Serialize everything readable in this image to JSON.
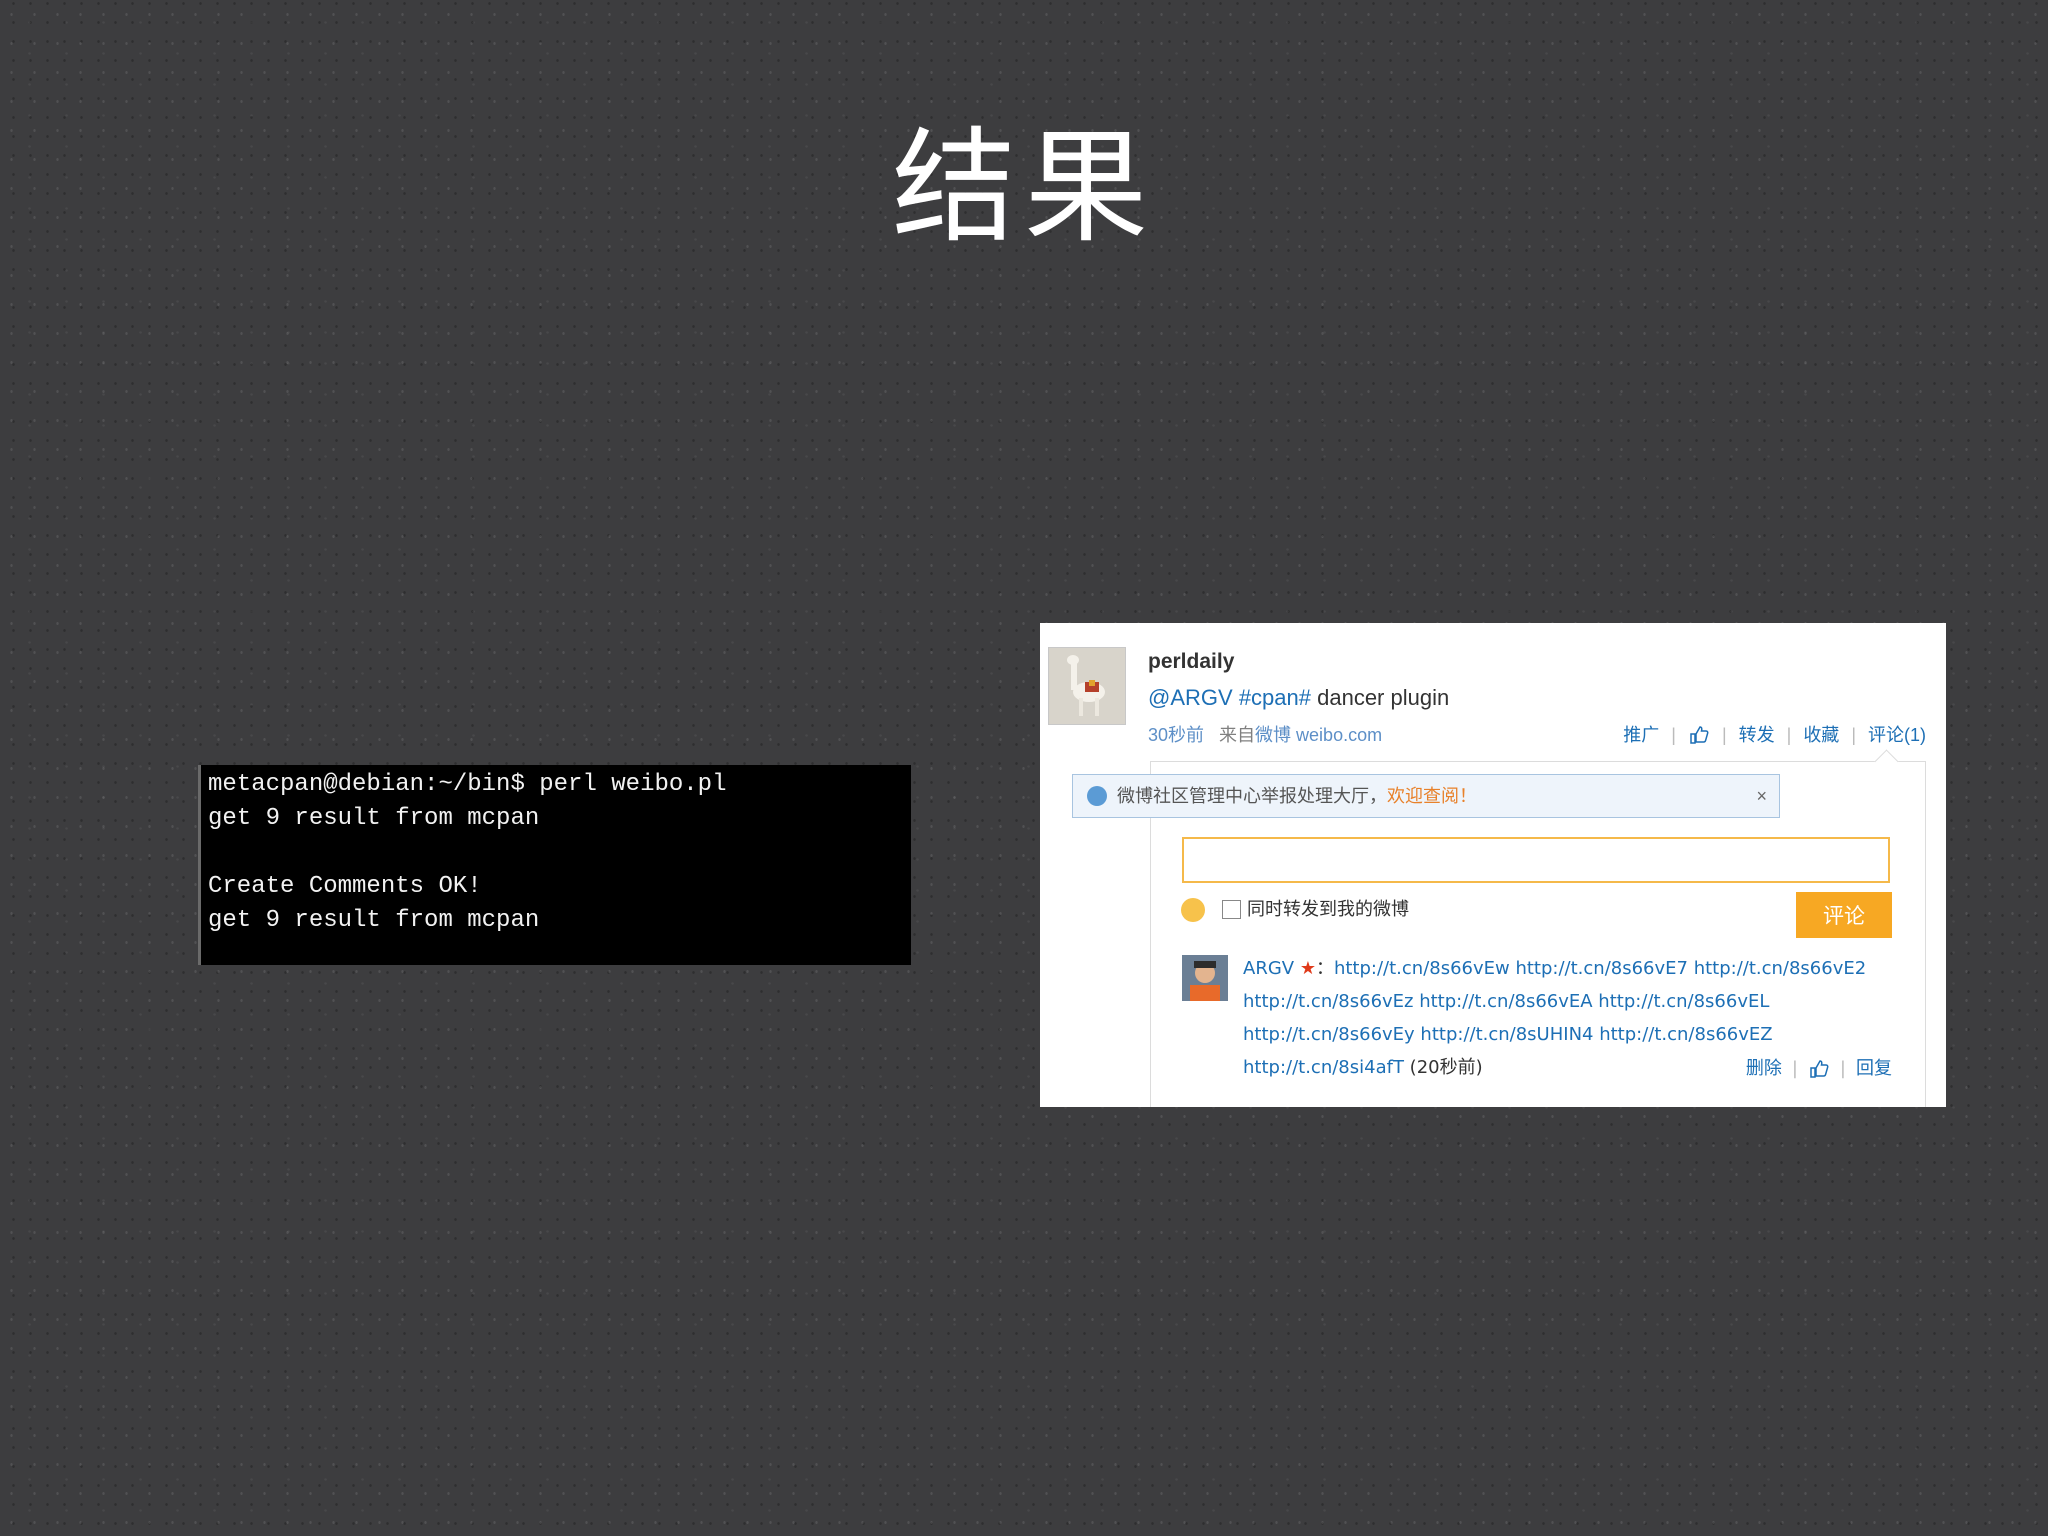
{
  "slide": {
    "title": "结果"
  },
  "terminal": {
    "lines": [
      "metacpan@debian:~/bin$ perl weibo.pl",
      "get 9 result from mcpan",
      "",
      "Create Comments OK!",
      "get 9 result from mcpan"
    ]
  },
  "post": {
    "username": "perldaily",
    "mention": "@ARGV",
    "hashtag": "#cpan#",
    "text": " dancer plugin",
    "time": "30秒前",
    "source_prefix": "来自",
    "source_app": "微博 weibo.com",
    "actions": {
      "promote": "推广",
      "repost": "转发",
      "favorite": "收藏",
      "comment": "评论(1)"
    }
  },
  "notice": {
    "text": "微博社区管理中心举报处理大厅，",
    "link": "欢迎查阅！",
    "close": "×"
  },
  "comment_form": {
    "input_value": "",
    "repost_label": "同时转发到我的微博",
    "submit_label": "评论"
  },
  "comment": {
    "author": "ARGV",
    "star": "★",
    "colon": "：",
    "links": "http://t.cn/8s66vEw http://t.cn/8s66vE7 http://t.cn/8s66vE2 http://t.cn/8s66vEz http://t.cn/8s66vEA http://t.cn/8s66vEL http://t.cn/8s66vEy http://t.cn/8sUHIN4 http://t.cn/8s66vEZ http://t.cn/8si4afT",
    "time": "(20秒前)",
    "actions": {
      "delete": "删除",
      "reply": "回复"
    }
  },
  "colors": {
    "link": "#1d6fb5",
    "submit": "#f7a823",
    "highlight": "#e8812a"
  }
}
